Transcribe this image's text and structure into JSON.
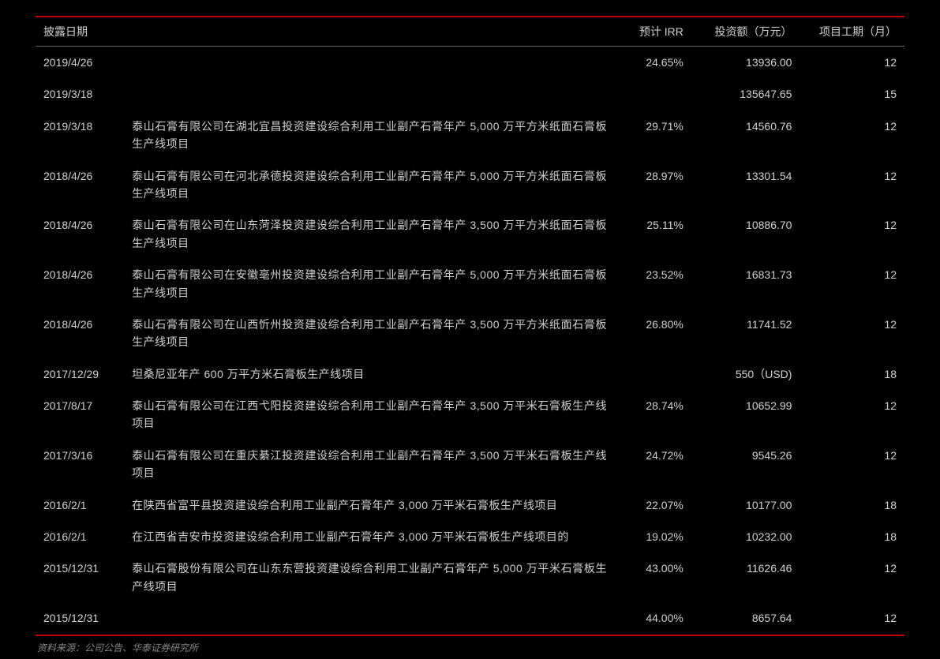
{
  "headers": {
    "date": "披露日期",
    "desc": "",
    "irr": "预计 IRR",
    "investment": "投资额（万元）",
    "duration": "项目工期（月）"
  },
  "rows": [
    {
      "date": "2019/4/26",
      "desc": "",
      "irr": "24.65%",
      "investment": "13936.00",
      "duration": "12"
    },
    {
      "date": "2019/3/18",
      "desc": "",
      "irr": "",
      "investment": "135647.65",
      "duration": "15"
    },
    {
      "date": "2019/3/18",
      "desc": "泰山石膏有限公司在湖北宜昌投资建设综合利用工业副产石膏年产 5,000 万平方米纸面石膏板生产线项目",
      "irr": "29.71%",
      "investment": "14560.76",
      "duration": "12"
    },
    {
      "date": "2018/4/26",
      "desc": "泰山石膏有限公司在河北承德投资建设综合利用工业副产石膏年产 5,000 万平方米纸面石膏板生产线项目",
      "irr": "28.97%",
      "investment": "13301.54",
      "duration": "12"
    },
    {
      "date": "2018/4/26",
      "desc": "泰山石膏有限公司在山东菏泽投资建设综合利用工业副产石膏年产 3,500 万平方米纸面石膏板生产线项目",
      "irr": "25.11%",
      "investment": "10886.70",
      "duration": "12"
    },
    {
      "date": "2018/4/26",
      "desc": "泰山石膏有限公司在安徽亳州投资建设综合利用工业副产石膏年产 5,000 万平方米纸面石膏板生产线项目",
      "irr": "23.52%",
      "investment": "16831.73",
      "duration": "12"
    },
    {
      "date": "2018/4/26",
      "desc": "泰山石膏有限公司在山西忻州投资建设综合利用工业副产石膏年产 3,500 万平方米纸面石膏板生产线项目",
      "irr": "26.80%",
      "investment": "11741.52",
      "duration": "12"
    },
    {
      "date": "2017/12/29",
      "desc": "坦桑尼亚年产 600 万平方米石膏板生产线项目",
      "irr": "",
      "investment": "550（USD)",
      "duration": "18"
    },
    {
      "date": "2017/8/17",
      "desc": "泰山石膏有限公司在江西弋阳投资建设综合利用工业副产石膏年产 3,500 万平米石膏板生产线项目",
      "irr": "28.74%",
      "investment": "10652.99",
      "duration": "12"
    },
    {
      "date": "2017/3/16",
      "desc": "泰山石膏有限公司在重庆綦江投资建设综合利用工业副产石膏年产 3,500 万平米石膏板生产线项目",
      "irr": "24.72%",
      "investment": "9545.26",
      "duration": "12"
    },
    {
      "date": "2016/2/1",
      "desc": "在陕西省富平县投资建设综合利用工业副产石膏年产 3,000 万平米石膏板生产线项目",
      "irr": "22.07%",
      "investment": "10177.00",
      "duration": "18"
    },
    {
      "date": "2016/2/1",
      "desc": "在江西省吉安市投资建设综合利用工业副产石膏年产 3,000 万平米石膏板生产线项目的",
      "irr": "19.02%",
      "investment": "10232.00",
      "duration": "18"
    },
    {
      "date": "2015/12/31",
      "desc": "泰山石膏股份有限公司在山东东营投资建设综合利用工业副产石膏年产 5,000 万平米石膏板生产线项目",
      "irr": "43.00%",
      "investment": "11626.46",
      "duration": "12"
    },
    {
      "date": "2015/12/31",
      "desc": "",
      "irr": "44.00%",
      "investment": "8657.64",
      "duration": "12"
    }
  ],
  "source": "资料来源：公司公告、华泰证券研究所"
}
